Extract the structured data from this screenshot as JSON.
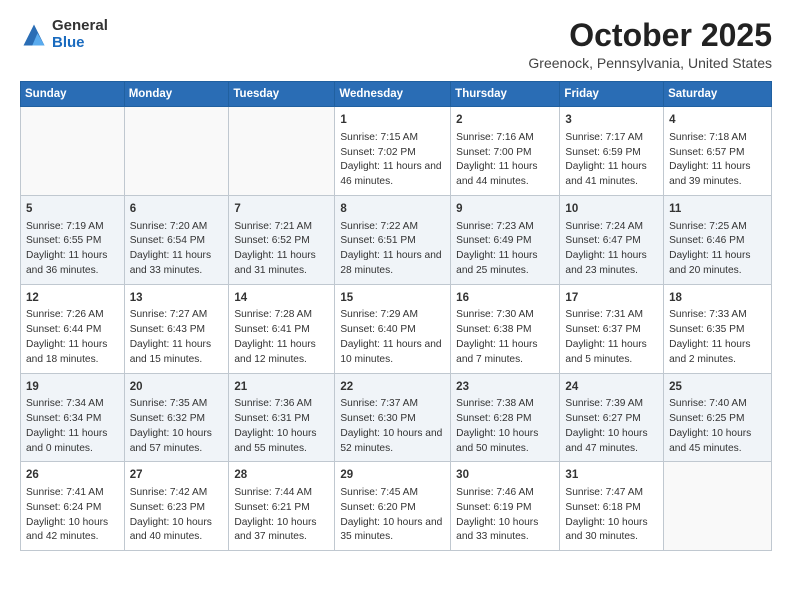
{
  "logo": {
    "general": "General",
    "blue": "Blue"
  },
  "title": "October 2025",
  "subtitle": "Greenock, Pennsylvania, United States",
  "days_of_week": [
    "Sunday",
    "Monday",
    "Tuesday",
    "Wednesday",
    "Thursday",
    "Friday",
    "Saturday"
  ],
  "weeks": [
    [
      {
        "day": "",
        "sunrise": "",
        "sunset": "",
        "daylight": ""
      },
      {
        "day": "",
        "sunrise": "",
        "sunset": "",
        "daylight": ""
      },
      {
        "day": "",
        "sunrise": "",
        "sunset": "",
        "daylight": ""
      },
      {
        "day": "1",
        "sunrise": "Sunrise: 7:15 AM",
        "sunset": "Sunset: 7:02 PM",
        "daylight": "Daylight: 11 hours and 46 minutes."
      },
      {
        "day": "2",
        "sunrise": "Sunrise: 7:16 AM",
        "sunset": "Sunset: 7:00 PM",
        "daylight": "Daylight: 11 hours and 44 minutes."
      },
      {
        "day": "3",
        "sunrise": "Sunrise: 7:17 AM",
        "sunset": "Sunset: 6:59 PM",
        "daylight": "Daylight: 11 hours and 41 minutes."
      },
      {
        "day": "4",
        "sunrise": "Sunrise: 7:18 AM",
        "sunset": "Sunset: 6:57 PM",
        "daylight": "Daylight: 11 hours and 39 minutes."
      }
    ],
    [
      {
        "day": "5",
        "sunrise": "Sunrise: 7:19 AM",
        "sunset": "Sunset: 6:55 PM",
        "daylight": "Daylight: 11 hours and 36 minutes."
      },
      {
        "day": "6",
        "sunrise": "Sunrise: 7:20 AM",
        "sunset": "Sunset: 6:54 PM",
        "daylight": "Daylight: 11 hours and 33 minutes."
      },
      {
        "day": "7",
        "sunrise": "Sunrise: 7:21 AM",
        "sunset": "Sunset: 6:52 PM",
        "daylight": "Daylight: 11 hours and 31 minutes."
      },
      {
        "day": "8",
        "sunrise": "Sunrise: 7:22 AM",
        "sunset": "Sunset: 6:51 PM",
        "daylight": "Daylight: 11 hours and 28 minutes."
      },
      {
        "day": "9",
        "sunrise": "Sunrise: 7:23 AM",
        "sunset": "Sunset: 6:49 PM",
        "daylight": "Daylight: 11 hours and 25 minutes."
      },
      {
        "day": "10",
        "sunrise": "Sunrise: 7:24 AM",
        "sunset": "Sunset: 6:47 PM",
        "daylight": "Daylight: 11 hours and 23 minutes."
      },
      {
        "day": "11",
        "sunrise": "Sunrise: 7:25 AM",
        "sunset": "Sunset: 6:46 PM",
        "daylight": "Daylight: 11 hours and 20 minutes."
      }
    ],
    [
      {
        "day": "12",
        "sunrise": "Sunrise: 7:26 AM",
        "sunset": "Sunset: 6:44 PM",
        "daylight": "Daylight: 11 hours and 18 minutes."
      },
      {
        "day": "13",
        "sunrise": "Sunrise: 7:27 AM",
        "sunset": "Sunset: 6:43 PM",
        "daylight": "Daylight: 11 hours and 15 minutes."
      },
      {
        "day": "14",
        "sunrise": "Sunrise: 7:28 AM",
        "sunset": "Sunset: 6:41 PM",
        "daylight": "Daylight: 11 hours and 12 minutes."
      },
      {
        "day": "15",
        "sunrise": "Sunrise: 7:29 AM",
        "sunset": "Sunset: 6:40 PM",
        "daylight": "Daylight: 11 hours and 10 minutes."
      },
      {
        "day": "16",
        "sunrise": "Sunrise: 7:30 AM",
        "sunset": "Sunset: 6:38 PM",
        "daylight": "Daylight: 11 hours and 7 minutes."
      },
      {
        "day": "17",
        "sunrise": "Sunrise: 7:31 AM",
        "sunset": "Sunset: 6:37 PM",
        "daylight": "Daylight: 11 hours and 5 minutes."
      },
      {
        "day": "18",
        "sunrise": "Sunrise: 7:33 AM",
        "sunset": "Sunset: 6:35 PM",
        "daylight": "Daylight: 11 hours and 2 minutes."
      }
    ],
    [
      {
        "day": "19",
        "sunrise": "Sunrise: 7:34 AM",
        "sunset": "Sunset: 6:34 PM",
        "daylight": "Daylight: 11 hours and 0 minutes."
      },
      {
        "day": "20",
        "sunrise": "Sunrise: 7:35 AM",
        "sunset": "Sunset: 6:32 PM",
        "daylight": "Daylight: 10 hours and 57 minutes."
      },
      {
        "day": "21",
        "sunrise": "Sunrise: 7:36 AM",
        "sunset": "Sunset: 6:31 PM",
        "daylight": "Daylight: 10 hours and 55 minutes."
      },
      {
        "day": "22",
        "sunrise": "Sunrise: 7:37 AM",
        "sunset": "Sunset: 6:30 PM",
        "daylight": "Daylight: 10 hours and 52 minutes."
      },
      {
        "day": "23",
        "sunrise": "Sunrise: 7:38 AM",
        "sunset": "Sunset: 6:28 PM",
        "daylight": "Daylight: 10 hours and 50 minutes."
      },
      {
        "day": "24",
        "sunrise": "Sunrise: 7:39 AM",
        "sunset": "Sunset: 6:27 PM",
        "daylight": "Daylight: 10 hours and 47 minutes."
      },
      {
        "day": "25",
        "sunrise": "Sunrise: 7:40 AM",
        "sunset": "Sunset: 6:25 PM",
        "daylight": "Daylight: 10 hours and 45 minutes."
      }
    ],
    [
      {
        "day": "26",
        "sunrise": "Sunrise: 7:41 AM",
        "sunset": "Sunset: 6:24 PM",
        "daylight": "Daylight: 10 hours and 42 minutes."
      },
      {
        "day": "27",
        "sunrise": "Sunrise: 7:42 AM",
        "sunset": "Sunset: 6:23 PM",
        "daylight": "Daylight: 10 hours and 40 minutes."
      },
      {
        "day": "28",
        "sunrise": "Sunrise: 7:44 AM",
        "sunset": "Sunset: 6:21 PM",
        "daylight": "Daylight: 10 hours and 37 minutes."
      },
      {
        "day": "29",
        "sunrise": "Sunrise: 7:45 AM",
        "sunset": "Sunset: 6:20 PM",
        "daylight": "Daylight: 10 hours and 35 minutes."
      },
      {
        "day": "30",
        "sunrise": "Sunrise: 7:46 AM",
        "sunset": "Sunset: 6:19 PM",
        "daylight": "Daylight: 10 hours and 33 minutes."
      },
      {
        "day": "31",
        "sunrise": "Sunrise: 7:47 AM",
        "sunset": "Sunset: 6:18 PM",
        "daylight": "Daylight: 10 hours and 30 minutes."
      },
      {
        "day": "",
        "sunrise": "",
        "sunset": "",
        "daylight": ""
      }
    ]
  ]
}
